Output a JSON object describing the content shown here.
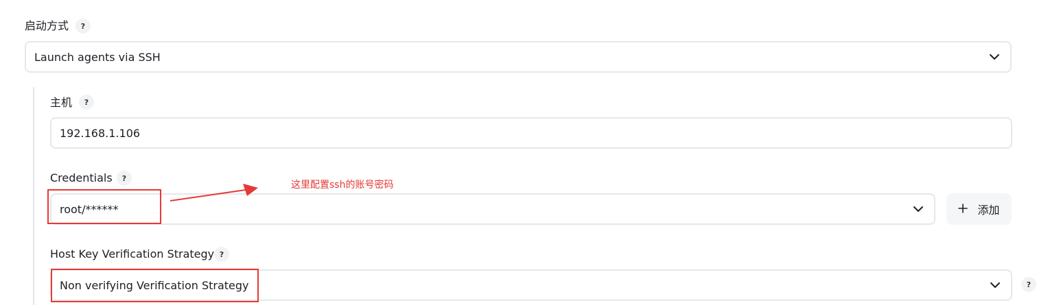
{
  "launch": {
    "label": "启动方式",
    "help": "?",
    "selected": "Launch agents via SSH"
  },
  "host": {
    "label": "主机",
    "help": "?",
    "value": "192.168.1.106"
  },
  "credentials": {
    "label": "Credentials",
    "help": "?",
    "selected": "root/******",
    "add_label": "添加",
    "add_icon": "plus-icon"
  },
  "host_key": {
    "label": "Host Key Verification Strategy",
    "help": "?",
    "selected": "Non verifying Verification Strategy"
  },
  "annotation": {
    "text": "这里配置ssh的账号密码",
    "color": "#e53935"
  },
  "side_help": "?"
}
